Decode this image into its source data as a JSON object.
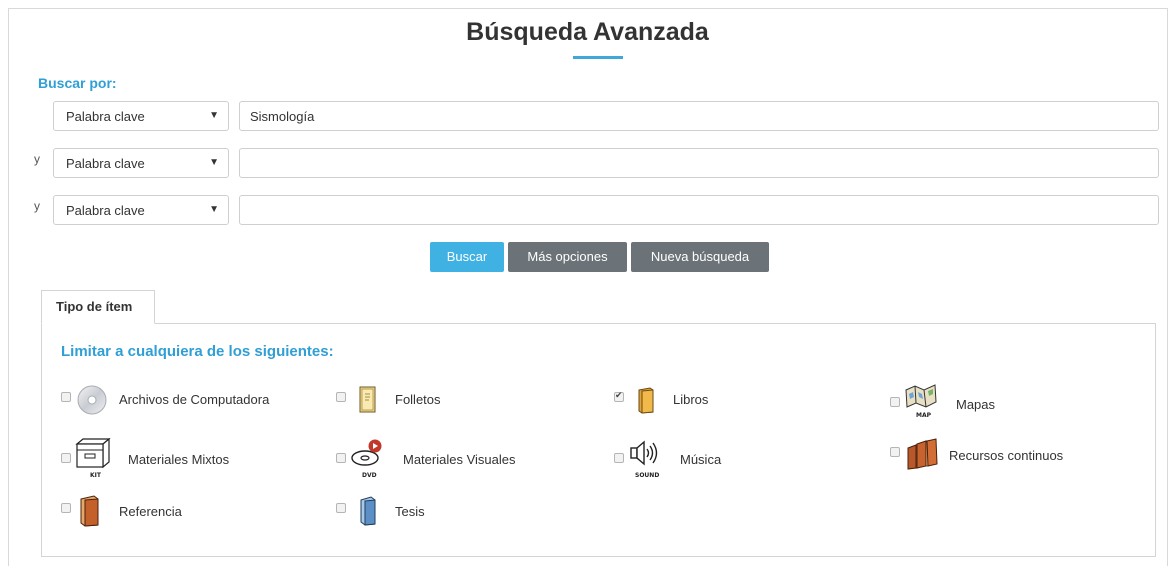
{
  "page": {
    "title": "Búsqueda Avanzada",
    "search_by_label": "Buscar por:"
  },
  "search_rows": [
    {
      "conjunction": "",
      "field": "Palabra clave",
      "value": "Sismología"
    },
    {
      "conjunction": "y",
      "field": "Palabra clave",
      "value": ""
    },
    {
      "conjunction": "y",
      "field": "Palabra clave",
      "value": ""
    }
  ],
  "buttons": {
    "search": "Buscar",
    "more_options": "Más opciones",
    "new_search": "Nueva búsqueda"
  },
  "tab": {
    "label": "Tipo de ítem"
  },
  "limit": {
    "heading": "Limitar a cualquiera de los siguientes:",
    "items": [
      {
        "label": "Archivos de Computadora",
        "checked": false,
        "icon": "cd-icon"
      },
      {
        "label": "Folletos",
        "checked": false,
        "icon": "pamphlet-icon"
      },
      {
        "label": "Libros",
        "checked": true,
        "icon": "book-icon"
      },
      {
        "label": "Mapas",
        "checked": false,
        "icon": "map-icon",
        "sub": "MAP"
      },
      {
        "label": "Materiales Mixtos",
        "checked": false,
        "icon": "kit-icon",
        "sub": "KIT"
      },
      {
        "label": "Materiales Visuales",
        "checked": false,
        "icon": "dvd-icon",
        "sub": "DVD"
      },
      {
        "label": "Música",
        "checked": false,
        "icon": "sound-icon",
        "sub": "SOUND"
      },
      {
        "label": "Recursos continuos",
        "checked": false,
        "icon": "serials-icon"
      },
      {
        "label": "Referencia",
        "checked": false,
        "icon": "reference-book-icon"
      },
      {
        "label": "Tesis",
        "checked": false,
        "icon": "thesis-book-icon"
      }
    ]
  },
  "colors": {
    "accent": "#3fa8d9",
    "primary_button": "#3fb1e3",
    "secondary_button": "#6b7378"
  }
}
